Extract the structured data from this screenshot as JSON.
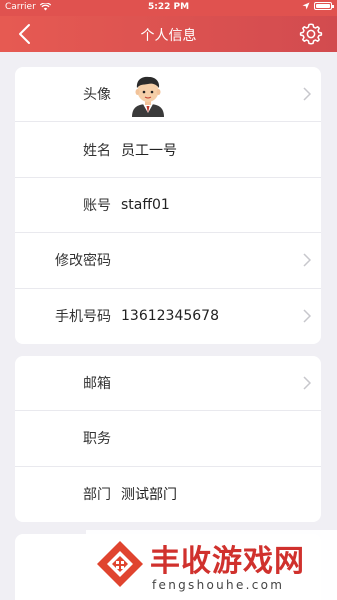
{
  "status_bar": {
    "carrier": "Carrier",
    "time": "5:22 PM"
  },
  "navbar": {
    "title": "个人信息",
    "back_icon": "chevron-left-icon",
    "settings_icon": "gear-icon"
  },
  "profile_section": {
    "rows": [
      {
        "label": "头像",
        "value": "",
        "has_chevron": true
      },
      {
        "label": "姓名",
        "value": "员工一号",
        "has_chevron": false
      },
      {
        "label": "账号",
        "value": "staff01",
        "has_chevron": false
      },
      {
        "label": "修改密码",
        "value": "",
        "has_chevron": true
      },
      {
        "label": "手机号码",
        "value": "13612345678",
        "has_chevron": true
      }
    ]
  },
  "work_section": {
    "rows": [
      {
        "label": "邮箱",
        "value": "",
        "has_chevron": true
      },
      {
        "label": "职务",
        "value": "",
        "has_chevron": false
      },
      {
        "label": "部门",
        "value": "测试部门",
        "has_chevron": false
      }
    ]
  },
  "watermark": {
    "title": "丰收游戏网",
    "subtitle": "fengshouhe.com"
  },
  "colors": {
    "header_red": "#e0524f",
    "background": "#f0eff4",
    "chevron": "#c7c7cc"
  }
}
